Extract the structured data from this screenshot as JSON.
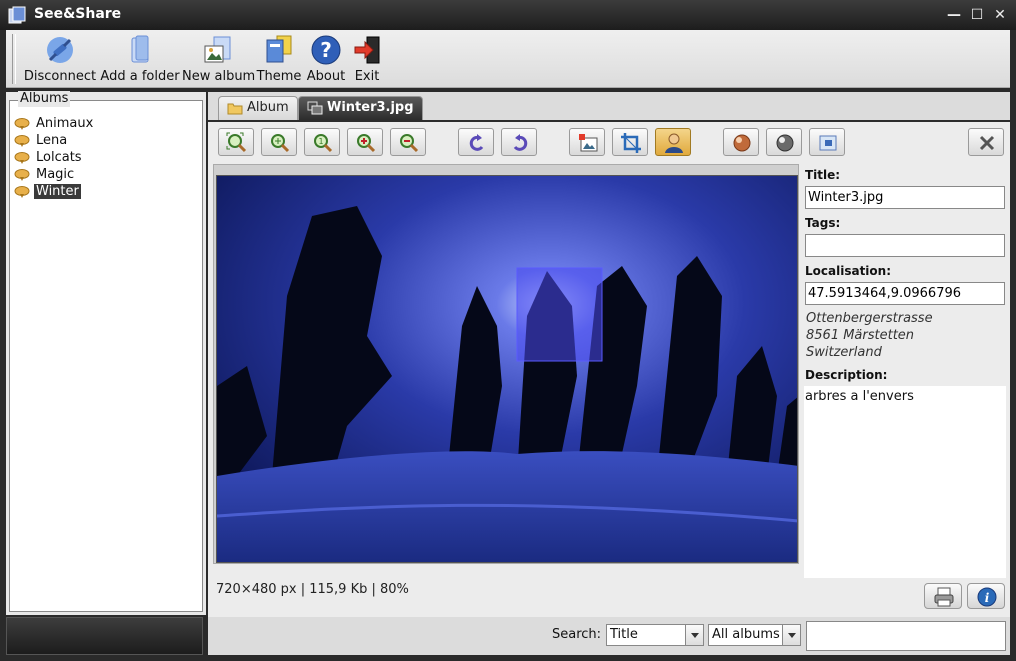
{
  "window": {
    "title": "See&Share"
  },
  "toolbar": {
    "items": [
      {
        "label": "Disconnect",
        "icon": "plug-icon"
      },
      {
        "label": "Add a folder",
        "icon": "folder-icon"
      },
      {
        "label": "New album",
        "icon": "album-icon"
      },
      {
        "label": "Theme",
        "icon": "theme-icon"
      },
      {
        "label": "About",
        "icon": "help-icon"
      },
      {
        "label": "Exit",
        "icon": "exit-icon"
      }
    ]
  },
  "albums": {
    "legend": "Albums",
    "items": [
      "Animaux",
      "Lena",
      "Lolcats",
      "Magic",
      "Winter"
    ],
    "selected": "Winter"
  },
  "tabs": [
    {
      "label": "Album",
      "active": false
    },
    {
      "label": "Winter3.jpg",
      "active": true
    }
  ],
  "image_toolbar": {
    "buttons": [
      "zoom-fit-icon",
      "zoom-actual-icon",
      "zoom-1to1-icon",
      "zoom-in-icon",
      "zoom-out-icon",
      "rotate-left-icon",
      "rotate-right-icon",
      "set-cover-icon",
      "crop-icon",
      "face-tag-icon",
      "sepia-icon",
      "grayscale-icon",
      "resize-icon",
      "close-icon"
    ],
    "pressed": "face-tag-icon"
  },
  "status": "720×480 px | 115,9 Kb | 80%",
  "properties": {
    "title_label": "Title:",
    "title_value": "Winter3.jpg",
    "tags_label": "Tags:",
    "tags_value": "",
    "localisation_label": "Localisation:",
    "localisation_value": "47.5913464,9.0966796",
    "address": [
      "Ottenbergerstrasse",
      "8561 Märstetten",
      "Switzerland"
    ],
    "description_label": "Description:",
    "description_value": "arbres a l'envers"
  },
  "search": {
    "label": "Search:",
    "field_value": "Title",
    "scope_value": "All albums",
    "query": ""
  },
  "colors": {
    "accent": "#e0a93c",
    "selection": "#3a3a3a",
    "face_box": "#4a4af0"
  }
}
